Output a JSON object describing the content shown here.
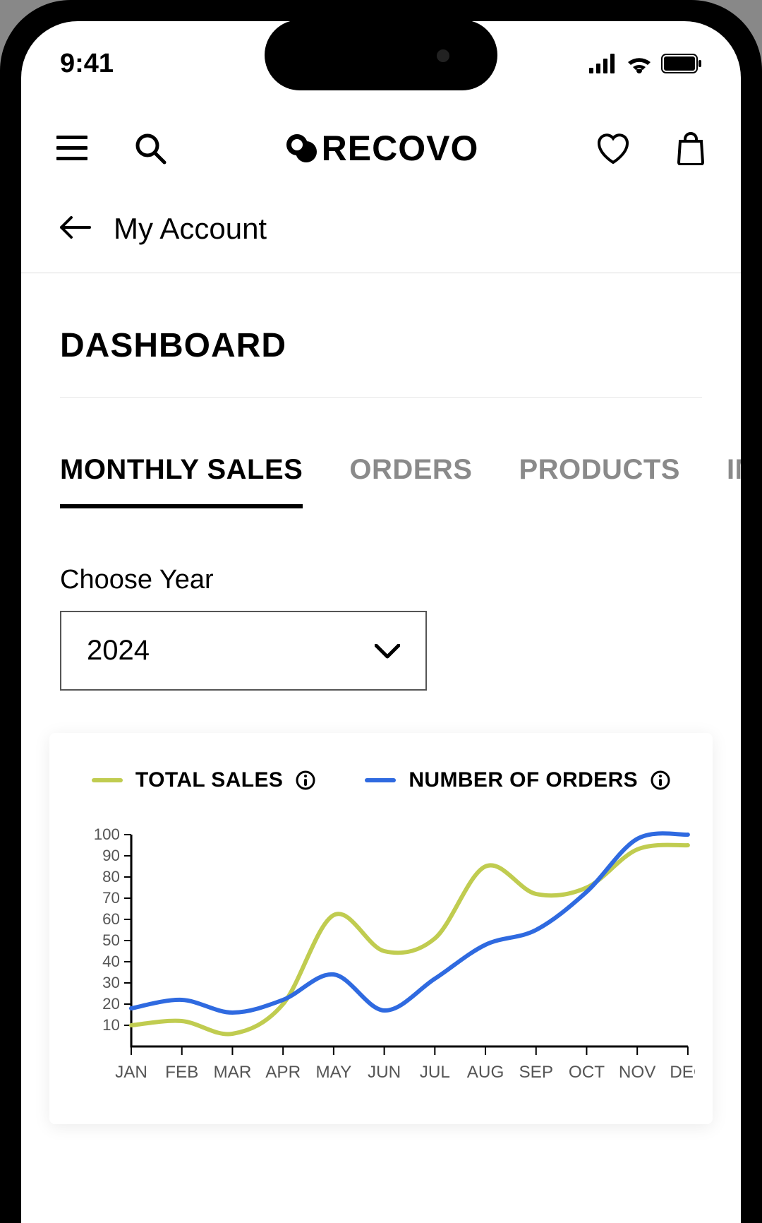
{
  "status": {
    "time": "9:41"
  },
  "header": {
    "brand": "RECOVO"
  },
  "breadcrumb": {
    "label": "My Account"
  },
  "page": {
    "title": "DASHBOARD"
  },
  "tabs": {
    "items": [
      {
        "label": "MONTHLY SALES",
        "active": true
      },
      {
        "label": "ORDERS",
        "active": false
      },
      {
        "label": "PRODUCTS",
        "active": false
      },
      {
        "label": "IMPA",
        "active": false
      }
    ]
  },
  "year_picker": {
    "label": "Choose Year",
    "value": "2024"
  },
  "legend": {
    "series1": {
      "label": "TOTAL SALES",
      "color": "#c0cc50"
    },
    "series2": {
      "label": "NUMBER OF ORDERS",
      "color": "#2f6ae0"
    }
  },
  "chart_data": {
    "type": "line",
    "title": "",
    "xlabel": "",
    "ylabel": "",
    "ylim": [
      0,
      100
    ],
    "y_ticks": [
      10,
      20,
      30,
      40,
      50,
      60,
      70,
      80,
      90,
      100
    ],
    "categories": [
      "JAN",
      "FEB",
      "MAR",
      "APR",
      "MAY",
      "JUN",
      "JUL",
      "AUG",
      "SEP",
      "OCT",
      "NOV",
      "DEC"
    ],
    "series": [
      {
        "name": "TOTAL SALES",
        "color": "#c0cc50",
        "values": [
          10,
          12,
          6,
          20,
          62,
          45,
          51,
          85,
          72,
          75,
          93,
          95
        ]
      },
      {
        "name": "NUMBER OF ORDERS",
        "color": "#2f6ae0",
        "values": [
          18,
          22,
          16,
          22,
          34,
          17,
          32,
          48,
          55,
          73,
          98,
          100
        ]
      }
    ]
  }
}
